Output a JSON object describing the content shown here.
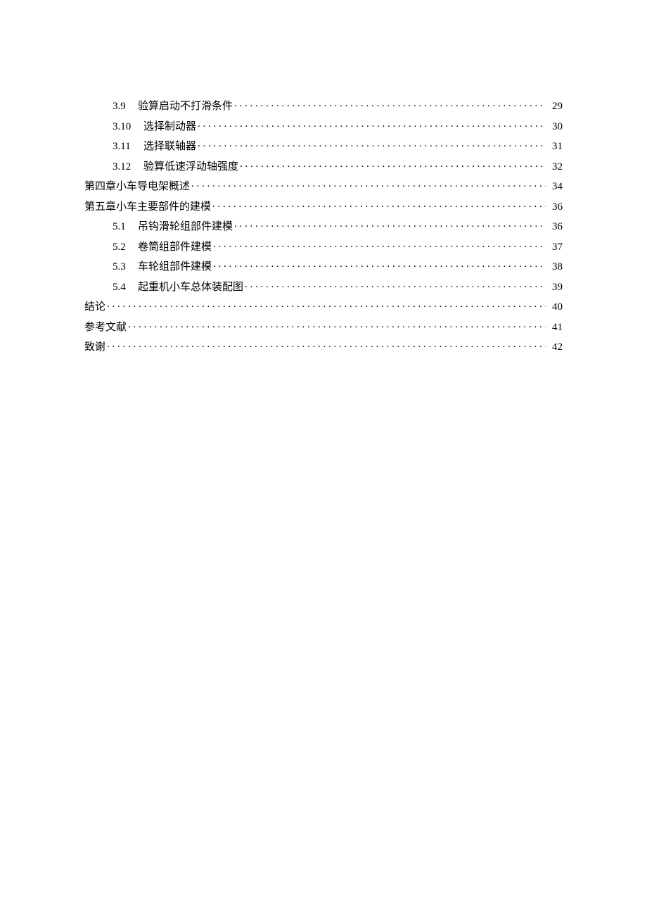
{
  "toc": [
    {
      "indent": 1,
      "num": "3.9",
      "wide": false,
      "title": "验算启动不打滑条件",
      "page": "29"
    },
    {
      "indent": 1,
      "num": "3.10",
      "wide": true,
      "title": "选择制动器",
      "page": "30"
    },
    {
      "indent": 1,
      "num": "3.11",
      "wide": true,
      "title": "选择联轴器",
      "page": "31"
    },
    {
      "indent": 1,
      "num": "3.12",
      "wide": true,
      "title": "验算低速浮动轴强度",
      "page": "32"
    },
    {
      "indent": 0,
      "num": "",
      "wide": false,
      "title": "第四章小车导电架概述",
      "page": "34"
    },
    {
      "indent": 0,
      "num": "",
      "wide": false,
      "title": "第五章小车主要部件的建模",
      "page": "36"
    },
    {
      "indent": 1,
      "num": "5.1",
      "wide": false,
      "title": "吊钩滑轮组部件建模",
      "page": "36"
    },
    {
      "indent": 1,
      "num": "5.2",
      "wide": false,
      "title": "卷筒组部件建模",
      "page": "37"
    },
    {
      "indent": 1,
      "num": "5.3",
      "wide": false,
      "title": "车轮组部件建模",
      "page": "38"
    },
    {
      "indent": 1,
      "num": "5.4",
      "wide": false,
      "title": "起重机小车总体装配图",
      "page": "39"
    },
    {
      "indent": 0,
      "num": "",
      "wide": false,
      "title": "结论",
      "page": "40"
    },
    {
      "indent": 0,
      "num": "",
      "wide": false,
      "title": "参考文献",
      "page": "41"
    },
    {
      "indent": 0,
      "num": "",
      "wide": false,
      "title": "致谢",
      "page": "42"
    }
  ]
}
